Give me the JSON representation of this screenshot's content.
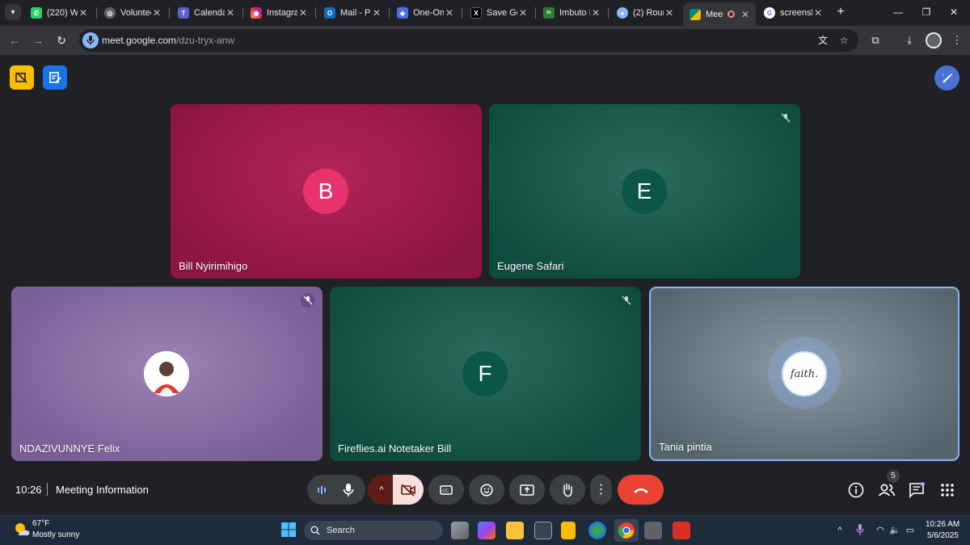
{
  "browser": {
    "tabs": [
      {
        "title": "(220) Wh",
        "favicon": "whatsapp-icon",
        "color": "#25d366"
      },
      {
        "title": "Volunteer",
        "favicon": "generic-site-icon",
        "color": "#9aa0a6"
      },
      {
        "title": "Calendar",
        "favicon": "teams-icon",
        "color": "#5b5fc7"
      },
      {
        "title": "Instagram",
        "favicon": "instagram-icon",
        "color": "#e1306c"
      },
      {
        "title": "Mail - Pr",
        "favicon": "outlook-icon",
        "color": "#0f6cbd"
      },
      {
        "title": "One-On",
        "favicon": "shield-icon",
        "color": "#4f6bed"
      },
      {
        "title": "Save Ge",
        "favicon": "x-icon",
        "color": "#000000"
      },
      {
        "title": "Imbuto I",
        "favicon": "imbuto-icon",
        "color": "#2e7d32"
      },
      {
        "title": "(2) Roun",
        "favicon": "chat-icon",
        "color": "#8ab4f8"
      },
      {
        "title": "Mee",
        "favicon": "meet-icon",
        "color": "#00897b",
        "active": true
      },
      {
        "title": "screensh",
        "favicon": "google-icon",
        "color": "#ffffff"
      }
    ],
    "url_host": "meet.google.com",
    "url_path": "/dzu-tryx-anw"
  },
  "meet": {
    "participants": [
      {
        "name": "Bill Nyirimihigo",
        "initial": "B",
        "avatar_color": "#e8336d",
        "muted": false
      },
      {
        "name": "Eugene Safari",
        "initial": "E",
        "avatar_color": "#0b5647",
        "muted": true
      },
      {
        "name": "NDAZIVUNNYE Felix",
        "initial": "",
        "avatar_color": "#ffffff",
        "muted": true
      },
      {
        "name": "Fireflies.ai Notetaker Bill",
        "initial": "F",
        "avatar_color": "#0b5647",
        "muted": true
      },
      {
        "name": "Tania pintia",
        "initial": "",
        "avatar_color": "#ffffff",
        "muted": false,
        "speaking": true
      }
    ],
    "avatar_text": "faith.",
    "time": "10:26",
    "meeting_info_label": "Meeting Information",
    "people_count": "5",
    "colors": {
      "hangup": "#ea4335",
      "camera_off_bg": "#f9dedc",
      "accent": "#8ab4f8"
    }
  },
  "taskbar": {
    "weather_temp": "67°F",
    "weather_desc": "Mostly sunny",
    "search_placeholder": "Search",
    "clock_time": "10:26 AM",
    "clock_date": "5/6/2025"
  }
}
